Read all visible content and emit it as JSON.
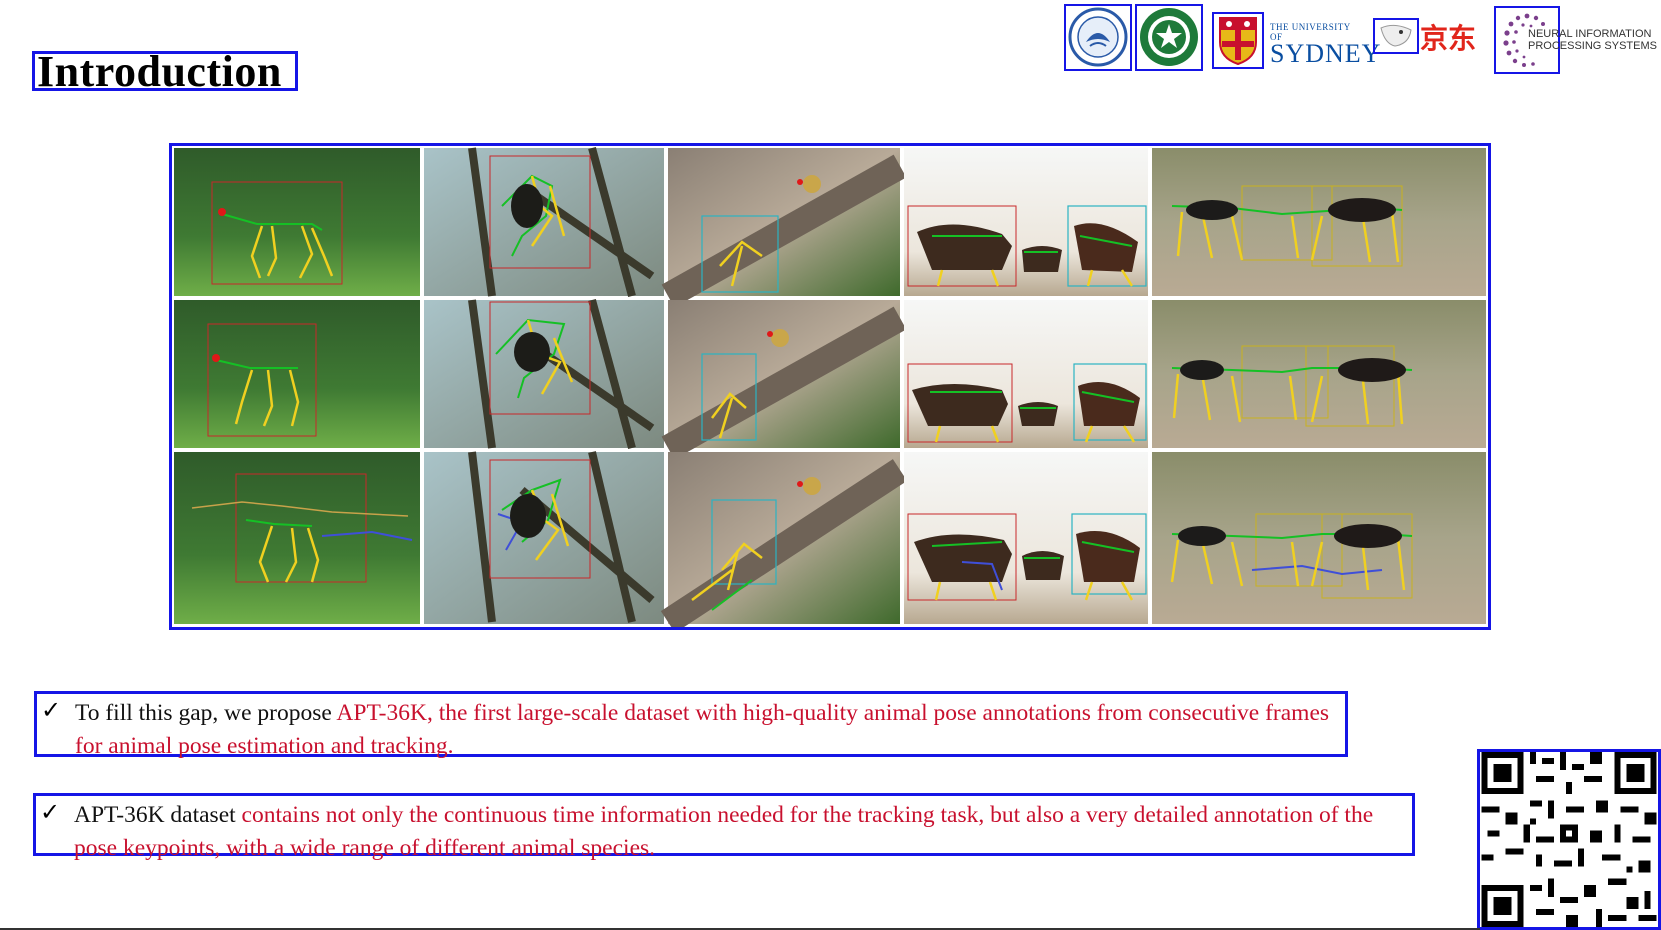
{
  "slide": {
    "title": "Introduction",
    "logos": [
      {
        "name": "university-seal-1-icon"
      },
      {
        "name": "university-seal-2-icon"
      },
      {
        "name": "sydney-crest-icon"
      },
      {
        "name": "sydney-wordmark",
        "text_top": "THE UNIVERSITY OF",
        "text_main": "SYDNEY"
      },
      {
        "name": "jd-mascot-icon"
      },
      {
        "name": "jd-wordmark",
        "text": "京东"
      },
      {
        "name": "neurips-logo-icon",
        "text_line1": "NEURAL INFORMATION",
        "text_line2": "PROCESSING SYSTEMS"
      }
    ],
    "figure": {
      "rows": 3,
      "columns": [
        "deer",
        "monkey-tree",
        "monkeys-trunk",
        "horses-white",
        "horses-dogs"
      ]
    },
    "bullets": [
      {
        "check": "✓",
        "plain": "To fill this gap, we propose ",
        "highlight": "APT-36K,  the first large-scale dataset with high-quality animal pose annotations from consecutive frames for animal pose estimation and tracking."
      },
      {
        "check": "✓",
        "plain": "APT-36K dataset ",
        "highlight": "contains not only the continuous time information needed for the tracking task, but also a very detailed annotation of the pose keypoints, with a wide range of different animal species."
      }
    ],
    "qr": {
      "name": "qr-code"
    },
    "colors": {
      "accent_border": "#1515e6",
      "highlight_text": "#c8102e"
    }
  }
}
